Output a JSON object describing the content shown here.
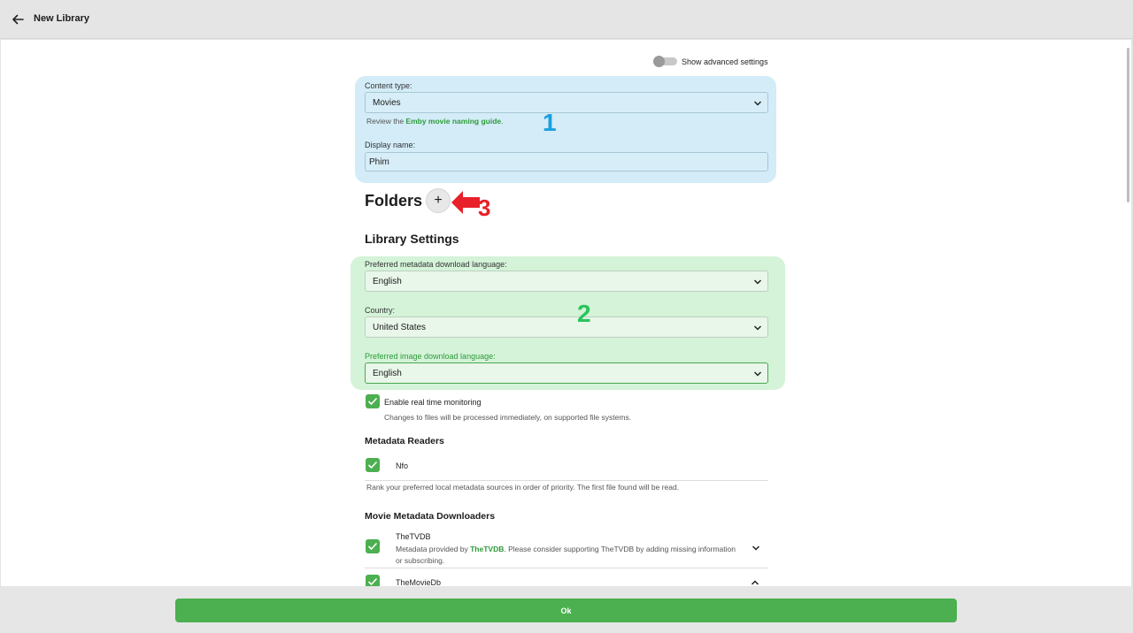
{
  "header": {
    "title": "New Library"
  },
  "advanced_toggle": {
    "label": "Show advanced settings"
  },
  "content_type": {
    "label": "Content type:",
    "value": "Movies",
    "help_prefix": "Review the ",
    "help_link": "Emby movie naming guide",
    "help_suffix": "."
  },
  "display_name": {
    "label": "Display name:",
    "value": "Phim"
  },
  "folders": {
    "heading": "Folders",
    "add_symbol": "+"
  },
  "library_settings": {
    "heading": "Library Settings",
    "metadata_language": {
      "label": "Preferred metadata download language:",
      "value": "English"
    },
    "country": {
      "label": "Country:",
      "value": "United States"
    },
    "image_language": {
      "label": "Preferred image download language:",
      "value": "English"
    }
  },
  "realtime": {
    "label": "Enable real time monitoring",
    "help": "Changes to files will be processed immediately, on supported file systems."
  },
  "metadata_readers": {
    "heading": "Metadata Readers",
    "items": [
      {
        "label": "Nfo"
      }
    ],
    "help": "Rank your preferred local metadata sources in order of priority. The first file found will be read."
  },
  "movie_downloaders": {
    "heading": "Movie Metadata Downloaders",
    "items": [
      {
        "name": "TheTVDB",
        "desc_prefix": "Metadata provided by ",
        "desc_link": "TheTVDB",
        "desc_suffix": ". Please consider supporting TheTVDB by adding missing information or subscribing."
      },
      {
        "name": "TheMovieDb"
      }
    ]
  },
  "annotations": {
    "one": "1",
    "two": "2",
    "three": "3"
  },
  "footer": {
    "ok_label": "Ok"
  },
  "colors": {
    "accent": "#4caf50",
    "annotation_blue": "#1aa0e0",
    "annotation_green": "#27c45a",
    "annotation_red": "#e8202a"
  }
}
